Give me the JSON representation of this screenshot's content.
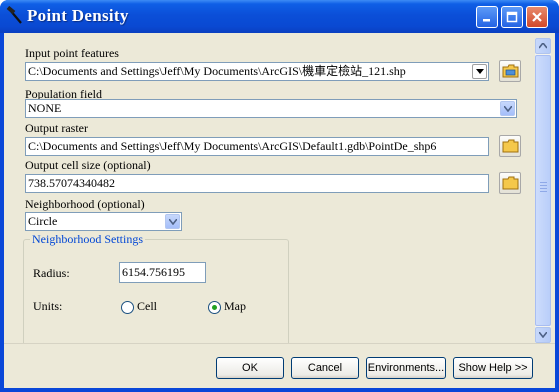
{
  "window": {
    "title": "Point Density"
  },
  "form": {
    "input_label": "Input point features",
    "input_value": "C:\\Documents and Settings\\Jeff\\My Documents\\ArcGIS\\機車定檢站_121.shp",
    "population_label": "Population field",
    "population_value": "NONE",
    "output_raster_label": "Output raster",
    "output_raster_value": "C:\\Documents and Settings\\Jeff\\My Documents\\ArcGIS\\Default1.gdb\\PointDe_shp6",
    "cell_size_label": "Output cell size (optional)",
    "cell_size_value": "738.57074340482",
    "neighborhood_label": "Neighborhood (optional)",
    "neighborhood_value": "Circle",
    "settings": {
      "title": "Neighborhood Settings",
      "radius_label": "Radius:",
      "radius_value": "6154.756195",
      "units_label": "Units:",
      "unit_cell": "Cell",
      "unit_map": "Map",
      "selected_unit": "Map"
    }
  },
  "buttons": {
    "ok": "OK",
    "cancel": "Cancel",
    "environments": "Environments...",
    "show_help": "Show Help >>"
  },
  "colors": {
    "titlebar": "#0a49d2",
    "client": "#ece9d8",
    "group_title": "#0046d5"
  }
}
